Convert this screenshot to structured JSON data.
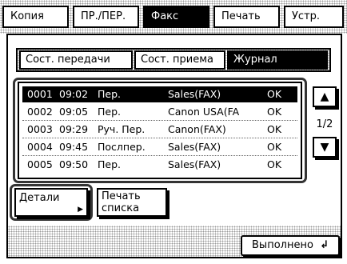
{
  "tabs": [
    {
      "label": "Копия"
    },
    {
      "label": "ПР./ПЕР."
    },
    {
      "label": "Факс"
    },
    {
      "label": "Печать"
    },
    {
      "label": "Устр."
    }
  ],
  "subtabs": [
    {
      "label": "Сост. передачи"
    },
    {
      "label": "Сост. приема"
    },
    {
      "label": "Журнал"
    }
  ],
  "rows": [
    {
      "num": "0001",
      "time": "09:02",
      "type": "Пер.",
      "dest": "Sales(FAX)",
      "status": "OK"
    },
    {
      "num": "0002",
      "time": "09:05",
      "type": "Пер.",
      "dest": "Canon USA(FA",
      "status": "OK"
    },
    {
      "num": "0003",
      "time": "09:29",
      "type": "Руч. Пер.",
      "dest": "Canon(FAX)",
      "status": "OK"
    },
    {
      "num": "0004",
      "time": "09:45",
      "type": "Послпер.",
      "dest": "Sales(FAX)",
      "status": "OK"
    },
    {
      "num": "0005",
      "time": "09:50",
      "type": "Пер.",
      "dest": "Sales(FAX)",
      "status": "OK"
    }
  ],
  "page_indicator": "1/2",
  "scroll_up_icon": "triangle-up-icon",
  "scroll_down_icon": "triangle-down-icon",
  "details_button": "Детали",
  "print_list_line1": "Печать",
  "print_list_line2": "списка",
  "done_button": "Выполнено",
  "done_icon": "return-arrow-icon"
}
